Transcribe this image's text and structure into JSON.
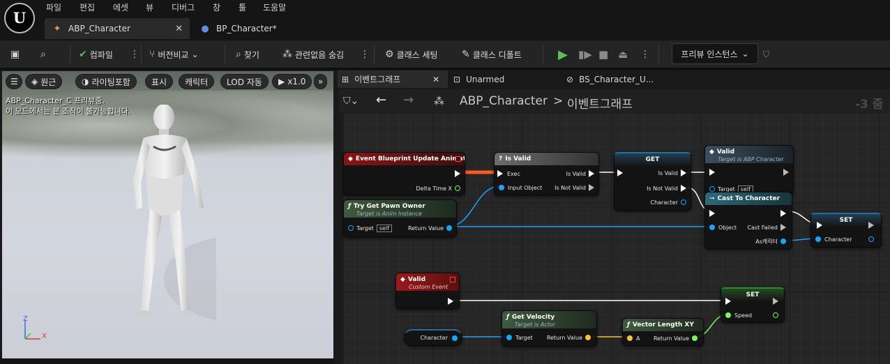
{
  "menu": {
    "file": "파일",
    "edit": "편집",
    "asset": "에셋",
    "view": "뷰",
    "debug": "디버그",
    "window": "창",
    "tools": "툴",
    "help": "도움말"
  },
  "tabs": [
    {
      "label": "ABP_Character"
    },
    {
      "label": "BP_Character*"
    }
  ],
  "toolbar": {
    "compile": "컴파일",
    "version_compare": "버전비교",
    "find": "찾기",
    "hide_unrelated": "관련없음 숨김",
    "class_settings": "클래스 세팅",
    "class_defaults": "클래스 디폴트",
    "preview_instance": "프리뷰 인스턴스"
  },
  "viewport": {
    "btn_perspective": "원근",
    "btn_lighting": "라이팅포함",
    "btn_show": "표시",
    "btn_character": "캐릭터",
    "btn_lod": "LOD 자동",
    "btn_speed": "x1.0",
    "overlay_line1": "ABP_Character_C 프리뷰중.",
    "overlay_line2": "이 모드에서는 본 조작이 불가능합니다.",
    "axis_z": "Z",
    "axis_x": "X"
  },
  "graph": {
    "tabs": [
      {
        "label": "이벤트그래프"
      },
      {
        "label": "Unarmed"
      },
      {
        "label": "BS_Character_U..."
      }
    ],
    "breadcrumb_root": "ABP_Character",
    "breadcrumb_sep": ">",
    "breadcrumb_leaf": "이벤트그래프",
    "zoom": "-3 줌",
    "nodes": {
      "event_update": {
        "title": "Event Blueprint Update Animation",
        "pin_delta": "Delta Time X"
      },
      "try_get_pawn": {
        "title": "Try Get Pawn Owner",
        "subtitle": "Target is Anim Instance",
        "pin_target": "Target",
        "self": "self",
        "pin_return": "Return Value"
      },
      "is_valid": {
        "title": "Is Valid",
        "pin_exec": "Exec",
        "pin_input": "Input Object",
        "pin_valid": "Is Valid",
        "pin_notvalid": "Is Not Valid"
      },
      "get": {
        "title": "GET",
        "pin_valid": "Is Valid",
        "pin_notvalid": "Is Not Valid",
        "pin_character": "Character"
      },
      "valid_call": {
        "title": "Valid",
        "subtitle": "Target is ABP Character",
        "pin_target": "Target",
        "self": "self"
      },
      "cast": {
        "title": "Cast To Character",
        "pin_object": "Object",
        "pin_failed": "Cast Failed",
        "pin_as": "As캐릭터"
      },
      "set1": {
        "title": "SET",
        "pin_character": "Character"
      },
      "valid_event": {
        "title": "Valid",
        "subtitle": "Custom Event"
      },
      "character_var": {
        "label": "Character"
      },
      "get_velocity": {
        "title": "Get Velocity",
        "subtitle": "Target is Actor",
        "pin_target": "Target",
        "pin_return": "Return Value"
      },
      "vector_length": {
        "title": "Vector Length XY",
        "pin_a": "A",
        "pin_return": "Return Value"
      },
      "set2": {
        "title": "SET",
        "pin_speed": "Speed"
      }
    }
  },
  "colors": {
    "exec": "#ffffff",
    "object": "#1aa3ff",
    "vector": "#f5c430",
    "float": "#7cf75a",
    "event_head": "#8a1414",
    "function_head": "#2f4a2f",
    "pure_head": "#3f5a3f",
    "accent_green": "#5ac05a"
  }
}
